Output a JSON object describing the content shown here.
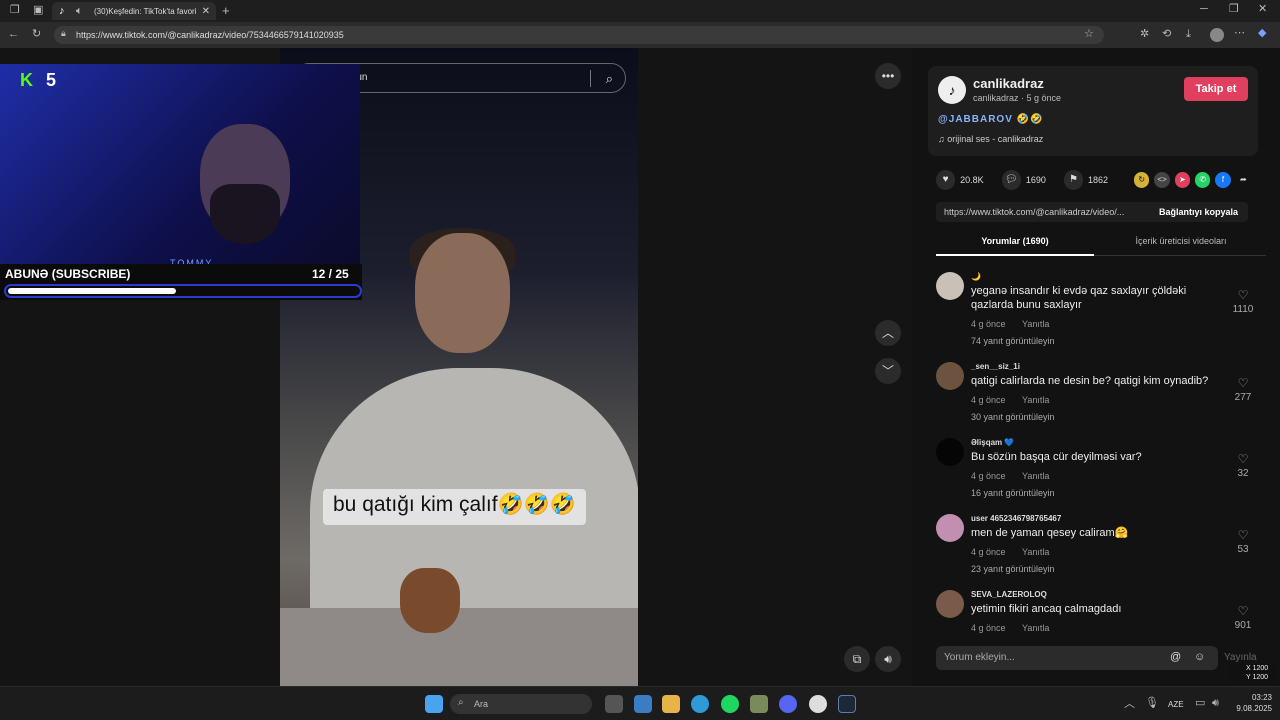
{
  "browser": {
    "tab_title": "(30)Keşfedin: TikTok'ta favori",
    "url": "https://www.tiktok.com/@canlikadraz/video/7534466579141020935"
  },
  "stream_overlay": {
    "kick_count": "5",
    "cam_text": "TOMMY",
    "subscribe_label": "ABUNƏ (SUBSCRIBE)",
    "subscribe_progress": "12  / 25",
    "progress_fraction": 0.48
  },
  "video": {
    "search_text": "bulun",
    "caption": "bu qatığı kim çalıf🤣🤣🤣"
  },
  "post": {
    "username": "canlikadraz",
    "subline": "canlikadraz · 5 g önce",
    "follow_label": "Takip et",
    "description": "@JABBAROV 🤣🤣",
    "music": "♫  orijinal ses - canlikadraz",
    "likes": "20.8K",
    "comments": "1690",
    "saves": "1862",
    "link": "https://www.tiktok.com/@canlikadraz/video/...",
    "copy_link_label": "Bağlantıyı kopyala"
  },
  "tabs": {
    "comments_tab": "Yorumlar (1690)",
    "creator_tab": "İçerik üreticisi videoları"
  },
  "comments": [
    {
      "name": "🌙",
      "text": "yeganə insandır ki evdə qaz saxlayır çöldəki qazlarda bunu saxlayır",
      "time": "4 g önce",
      "reply": "Yanıtla",
      "more": "74 yanıt görüntüleyin",
      "likes": "1110",
      "avatar": "#c9c0b8"
    },
    {
      "name": "_sen__siz_1i",
      "text": "qatigi calirlarda ne desin be? qatigi kim oynadib?",
      "time": "4 g önce",
      "reply": "Yanıtla",
      "more": "30 yanıt görüntüleyin",
      "likes": "277",
      "avatar": "#6b5340"
    },
    {
      "name": "Əlişqam 💙",
      "text": "Bu sözün başqa cür deyilməsi var?",
      "time": "4 g önce",
      "reply": "Yanıtla",
      "more": "16 yanıt görüntüleyin",
      "likes": "32",
      "avatar": "#050505"
    },
    {
      "name": "user 4652346798765467",
      "text": "men de yaman qesey caliram🤗",
      "time": "4 g önce",
      "reply": "Yanıtla",
      "more": "23 yanıt görüntüleyin",
      "likes": "53",
      "avatar": "#c28fb0"
    },
    {
      "name": "SEVA_LAZEROLOQ",
      "text": "yetimin fikiri ancaq calmagdadı",
      "time": "4 g önce",
      "reply": "Yanıtla",
      "more": "",
      "likes": "901",
      "avatar": "#7a5a4a"
    }
  ],
  "comment_input": {
    "placeholder": "Yorum ekleyin...",
    "post_label": "Yayınla"
  },
  "taskbar": {
    "search_placeholder": "Ara",
    "lang": "AZE",
    "time": "03:23",
    "date": "9.08.2025"
  },
  "coords_overlay": {
    "x": "X 1200",
    "y": "Y 1200"
  },
  "colors": {
    "follow": "#e0405d",
    "kick_green": "#53fc18",
    "progress_border": "#2b3bd0"
  }
}
